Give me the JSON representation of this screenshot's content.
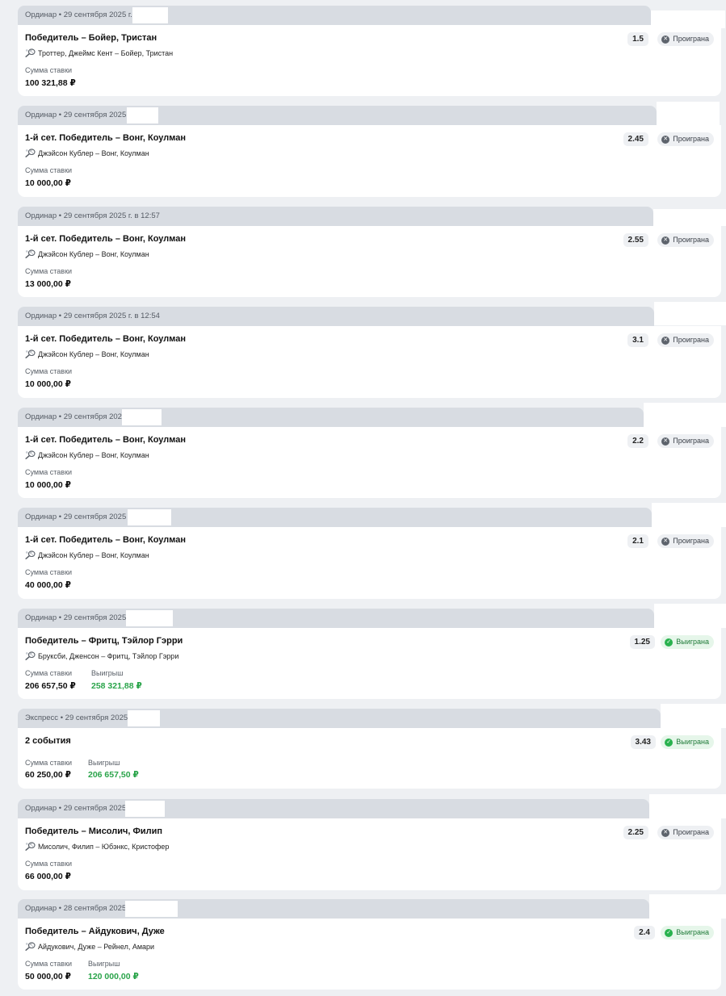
{
  "bets": [
    {
      "header": "Ординар • 29 сентября 2025 г. в",
      "title": "Победитель – Бойер, Тристан",
      "event": "Троттер, Джеймс Кент – Бойер, Тристан",
      "odds": "1.5",
      "status": "Проиграна",
      "result": "lost",
      "stake_label": "Сумма ставки",
      "stake": "100 321,88 ₽"
    },
    {
      "header": "Ординар • 29 сентября 2025 г.",
      "title": "1-й сет. Победитель – Вонг, Коулман",
      "event": "Джэйсон Кублер – Вонг, Коулман",
      "odds": "2.45",
      "status": "Проиграна",
      "result": "lost",
      "stake_label": "Сумма ставки",
      "stake": "10 000,00 ₽"
    },
    {
      "header": "Ординар • 29 сентября 2025 г. в 12:57",
      "title": "1-й сет. Победитель – Вонг, Коулман",
      "event": "Джэйсон Кублер – Вонг, Коулман",
      "odds": "2.55",
      "status": "Проиграна",
      "result": "lost",
      "stake_label": "Сумма ставки",
      "stake": "13 000,00 ₽"
    },
    {
      "header": "Ординар • 29 сентября 2025 г. в 12:54",
      "title": "1-й сет. Победитель – Вонг, Коулман",
      "event": "Джэйсон Кублер – Вонг, Коулман",
      "odds": "3.1",
      "status": "Проиграна",
      "result": "lost",
      "stake_label": "Сумма ставки",
      "stake": "10 000,00 ₽"
    },
    {
      "header": "Ординар • 29 сентября 2025",
      "title": "1-й сет. Победитель – Вонг, Коулман",
      "event": "Джэйсон Кублер – Вонг, Коулман",
      "odds": "2.2",
      "status": "Проиграна",
      "result": "lost",
      "stake_label": "Сумма ставки",
      "stake": "10 000,00 ₽"
    },
    {
      "header": "Ординар • 29 сентября 2025 г.",
      "title": "1-й сет. Победитель – Вонг, Коулман",
      "event": "Джэйсон Кублер – Вонг, Коулман",
      "odds": "2.1",
      "status": "Проиграна",
      "result": "lost",
      "stake_label": "Сумма ставки",
      "stake": "40 000,00 ₽"
    },
    {
      "header": "Ординар • 29 сентября 2025 г",
      "title": "Победитель – Фритц, Тэйлор Гэрри",
      "event": "Бруксби, Дженсон – Фритц, Тэйлор Гэрри",
      "odds": "1.25",
      "status": "Выиграна",
      "result": "won",
      "stake_label": "Сумма ставки",
      "stake": "206 657,50 ₽",
      "win_label": "Выигрыш",
      "win": "258 321,88 ₽"
    },
    {
      "header": "Экспресс • 29 сентября 2025 г.",
      "title": "2 события",
      "event": "",
      "odds": "3.43",
      "status": "Выиграна",
      "result": "won",
      "stake_label": "Сумма ставки",
      "stake": "60 250,00 ₽",
      "win_label": "Выигрыш",
      "win": "206 657,50 ₽"
    },
    {
      "header": "Ординар • 29 сентября 2025 г",
      "title": "Победитель – Мисолич, Филип",
      "event": "Мисолич, Филип – Юбэнкс, Кристофер",
      "odds": "2.25",
      "status": "Проиграна",
      "result": "lost",
      "stake_label": "Сумма ставки",
      "stake": "66 000,00 ₽"
    },
    {
      "header": "Ординар • 28 сентября 2025 г",
      "title": "Победитель – Айдукович, Дуже",
      "event": "Айдукович, Дуже – Рейнел, Амари",
      "odds": "2.4",
      "status": "Выиграна",
      "result": "won",
      "stake_label": "Сумма ставки",
      "stake": "50 000,00 ₽",
      "win_label": "Выигрыш",
      "win": "120 000,00 ₽"
    }
  ]
}
